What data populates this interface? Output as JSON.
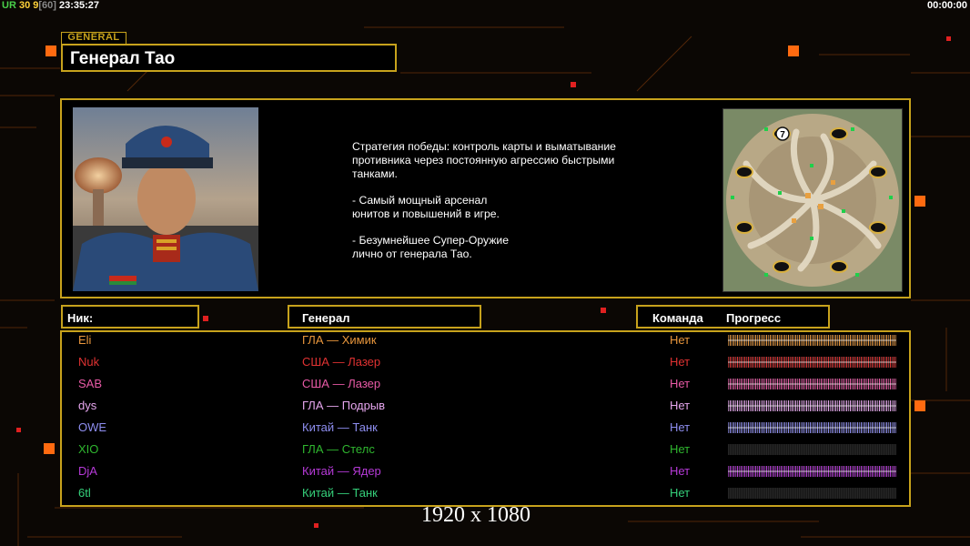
{
  "hud": {
    "left_parts": [
      {
        "text": "UR",
        "color": "#4ad04a"
      },
      {
        "text": " 30 ",
        "color": "#ffd23a"
      },
      {
        "text": "9",
        "color": "#ffd23a"
      },
      {
        "text": "[60]",
        "color": "#888888"
      },
      {
        "text": " 23:35:27",
        "color": "#ffffff"
      }
    ],
    "timer": "00:00:00"
  },
  "tag": "GENERAL",
  "general_name": "Генерал Тао",
  "description": [
    "Стратегия победы: контроль карты и выматывание\n противника через постоянную агрессию быстрыми\n танками.",
    "- Самый мощный арсенал\nюнитов и повышений в игре.",
    "- Безумнейшее Супер-Оружие\nлично от генерала Тао."
  ],
  "map": {
    "start_label": "7"
  },
  "headers": {
    "nick": "Ник:",
    "general": "Генерал",
    "team": "Команда",
    "progress": "Прогресс"
  },
  "players": [
    {
      "nick": "Eli",
      "general": "ГЛА — Химик",
      "team": "Нет",
      "color": "#e8963c",
      "progress": 1.0
    },
    {
      "nick": "Nuk",
      "general": "США — Лазер",
      "team": "Нет",
      "color": "#e03232",
      "progress": 1.0
    },
    {
      "nick": "SAB",
      "general": "США — Лазер",
      "team": "Нет",
      "color": "#e85aa6",
      "progress": 1.0
    },
    {
      "nick": "dys",
      "general": "ГЛА — Подрыв",
      "team": "Нет",
      "color": "#e6a6ee",
      "progress": 1.0
    },
    {
      "nick": "OWE",
      "general": "Китай — Танк",
      "team": "Нет",
      "color": "#8e8ef0",
      "progress": 1.0
    },
    {
      "nick": "XIO",
      "general": "ГЛА — Стелс",
      "team": "Нет",
      "color": "#2fb62f",
      "progress": 0.0
    },
    {
      "nick": "DjA",
      "general": "Китай — Ядер",
      "team": "Нет",
      "color": "#b63ad8",
      "progress": 1.0
    },
    {
      "nick": "6tl",
      "general": "Китай — Танк",
      "team": "Нет",
      "color": "#35d07a",
      "progress": 0.0
    }
  ],
  "caption": "1920 x 1080"
}
